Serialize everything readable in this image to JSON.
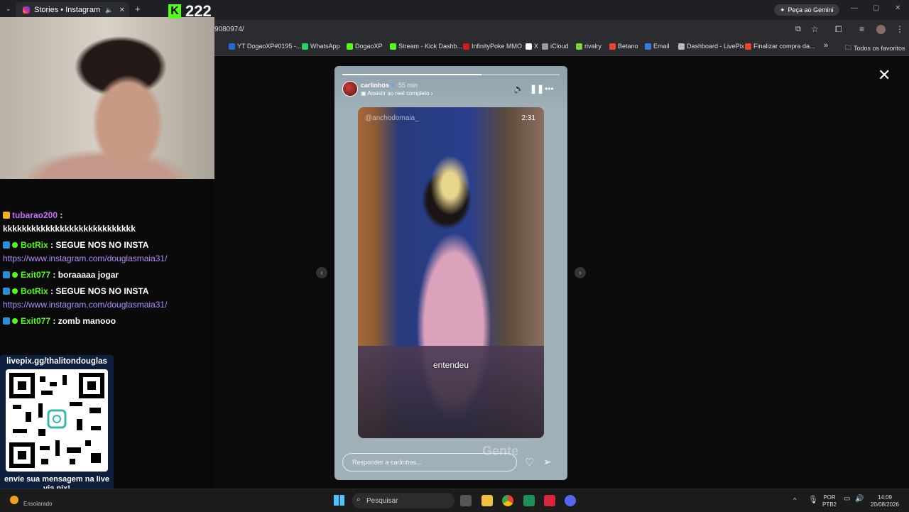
{
  "browser": {
    "tab_title": "Stories • Instagram",
    "url_fragment": "9080974/",
    "gemini_label": "Peça ao Gemini",
    "bookmarks": [
      {
        "label": "YT DogaoXP#0195 -...",
        "color": "#1e6bd6"
      },
      {
        "label": "WhatsApp",
        "color": "#25d366"
      },
      {
        "label": "DogaoXP",
        "color": "#53fc18"
      },
      {
        "label": "Stream - Kick Dashb...",
        "color": "#53fc18"
      },
      {
        "label": "InfinityPoke MMO",
        "color": "#d21a1a"
      },
      {
        "label": "X",
        "color": "#ffffff"
      },
      {
        "label": "iCloud",
        "color": "#999999"
      },
      {
        "label": "rivalry",
        "color": "#7fd13b"
      },
      {
        "label": "Betano",
        "color": "#e8452c"
      },
      {
        "label": "Email",
        "color": "#2f7de1"
      },
      {
        "label": "Dashboard - LivePix",
        "color": "#bbbbbb"
      },
      {
        "label": "Finalizar compra da...",
        "color": "#e8452c"
      }
    ],
    "bookmarks_more": "»",
    "all_favorites": "Todos os favoritos"
  },
  "stream": {
    "kick_count": "222",
    "chat": [
      {
        "user": "tubarao200",
        "color": "#c86bff",
        "text": "kkkkkkkkkkkkkkkkkkkkkkkkkkkk",
        "wrap": true
      },
      {
        "user": "BotRix",
        "color": "#53fc18",
        "text": "SEGUE NOS NO INSTA",
        "link": "https://www.instagram.com/douglasmaia31/"
      },
      {
        "user": "Exit077",
        "color": "#53fc18",
        "text": "boraaaaa jogar"
      },
      {
        "user": "BotRix",
        "color": "#53fc18",
        "text": "SEGUE NOS NO INSTA",
        "link": "https://www.instagram.com/douglasmaia31/"
      },
      {
        "user": "Exit077",
        "color": "#53fc18",
        "text": "zomb manooo"
      }
    ],
    "livepix_title": "livepix.gg/thalitondouglas",
    "livepix_footer": "envie sua mensagem na live via pix!"
  },
  "story": {
    "username": "carlinhos",
    "time": "55 min",
    "subtitle": "Assistir ao reel completo",
    "video_watermark": "@anchodomaia_",
    "video_timestamp": "2:31",
    "caption": "entendeu",
    "ghost_text": "Gente",
    "reply_placeholder": "Responder a carlinhos..."
  },
  "taskbar": {
    "weather": "Ensolarado",
    "search_placeholder": "Pesquisar",
    "lang_top": "POR",
    "lang_bottom": "PTB2",
    "time": "14:09",
    "date": "20/08/2026"
  }
}
